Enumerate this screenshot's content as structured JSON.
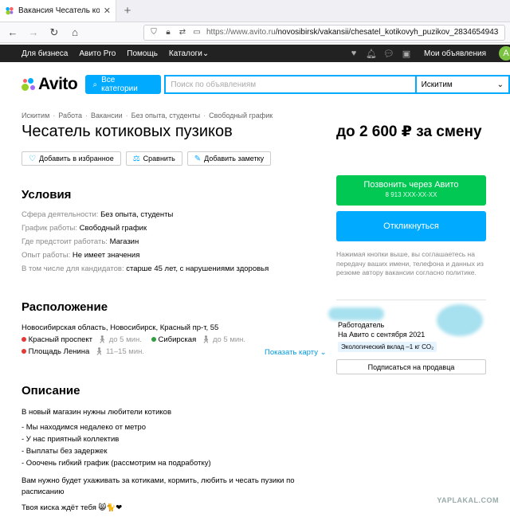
{
  "browser": {
    "tab_title": "Вакансия Чесатель котиковых",
    "tab_close": "✕",
    "new_tab": "+",
    "url_host": "https://www.avito.ru",
    "url_path": "/novosibirsk/vakansii/chesatel_kotikovyh_puzikov_2834654943"
  },
  "topbar": {
    "items": [
      "Для бизнеса",
      "Авито Pro",
      "Помощь",
      "Каталоги"
    ],
    "my_ads": "Мои объявления",
    "avatar_letter": "А"
  },
  "header": {
    "logo": "Avito",
    "categories_button": "Все категории",
    "search_placeholder": "Поиск по объявлениям",
    "city": "Искитим"
  },
  "breadcrumb": [
    "Искитим",
    "Работа",
    "Вакансии",
    "Без опыта, студенты",
    "Свободный график"
  ],
  "title": "Чесатель котиковых пузиков",
  "price": "до 2 600 ₽ за смену",
  "actions": {
    "favorite": "Добавить в избранное",
    "compare": "Сравнить",
    "note": "Добавить заметку"
  },
  "conditions": {
    "heading": "Условия",
    "rows": [
      {
        "label": "Сфера деятельности:",
        "value": "Без опыта, студенты"
      },
      {
        "label": "График работы:",
        "value": "Свободный график"
      },
      {
        "label": "Где предстоит работать:",
        "value": "Магазин"
      },
      {
        "label": "Опыт работы:",
        "value": "Не имеет значения"
      },
      {
        "label": "В том числе для кандидатов:",
        "value": "старше 45 лет, с нарушениями здоровья"
      }
    ]
  },
  "location": {
    "heading": "Расположение",
    "address": "Новосибирская область, Новосибирск, Красный пр-т, 55",
    "metro": [
      {
        "name": "Красный проспект",
        "time": "до 5 мин.",
        "color": "#e53935"
      },
      {
        "name": "Сибирская",
        "time": "до 5 мин.",
        "color": "#2e9e3e"
      },
      {
        "name": "Площадь Ленина",
        "time": "11–15 мин.",
        "color": "#e53935"
      }
    ],
    "show_map": "Показать карту"
  },
  "description": {
    "heading": "Описание",
    "intro": "В новый магазин нужны любители котиков",
    "list": [
      "- Мы находимся недалеко от метро",
      "- У нас приятный коллектив",
      "- Выплаты без задержек",
      "- Ооочень гибкий график (рассмотрим на подработку)"
    ],
    "para1": "Вам нужно будет ухаживать за котиками, кормить, любить и чесать пузики по расписанию",
    "para2": "Твоя киска ждёт тебя 😸🐈❤"
  },
  "sidebar": {
    "call_button": "Позвонить через Авито",
    "call_phone": "8 913 XXX-XX-XX",
    "respond_button": "Откликнуться",
    "note": "Нажимая кнопки выше, вы соглашаетесь на передачу ваших имени, телефона и данных из резюме автору вакансии согласно политике.",
    "employer_label": "Работодатель",
    "employer_since": "На Авито с сентября 2021",
    "eco_badge": "Экологический вклад –1 кг CO₂",
    "subscribe_button": "Подписаться на продавца"
  },
  "watermark": "YAPLAKAL.COM",
  "colors": {
    "accent": "#00aaff",
    "call_green": "#00c853",
    "topbar": "#222222"
  }
}
